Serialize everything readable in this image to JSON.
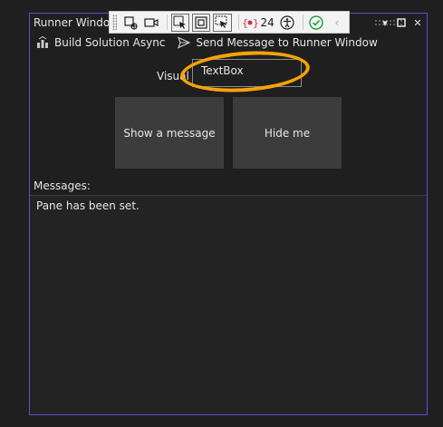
{
  "window": {
    "title": "Runner Window"
  },
  "floating_toolbar": {
    "issue_count": "24"
  },
  "toolbar": {
    "build_label": "Build Solution Async",
    "send_label": "Send Message to Runner Window"
  },
  "content": {
    "visual_label": "Visual S",
    "textbox_value": "TextBox",
    "show_button": "Show a message",
    "hide_button": "Hide me",
    "messages_label": "Messages:",
    "message_text": "Pane has been set."
  },
  "colors": {
    "accent_border": "#5b4fd0",
    "highlight": "#f5a30a",
    "button_bg": "#3c3c3c",
    "check_green": "#1e9e3a",
    "error_red": "#d13438"
  }
}
